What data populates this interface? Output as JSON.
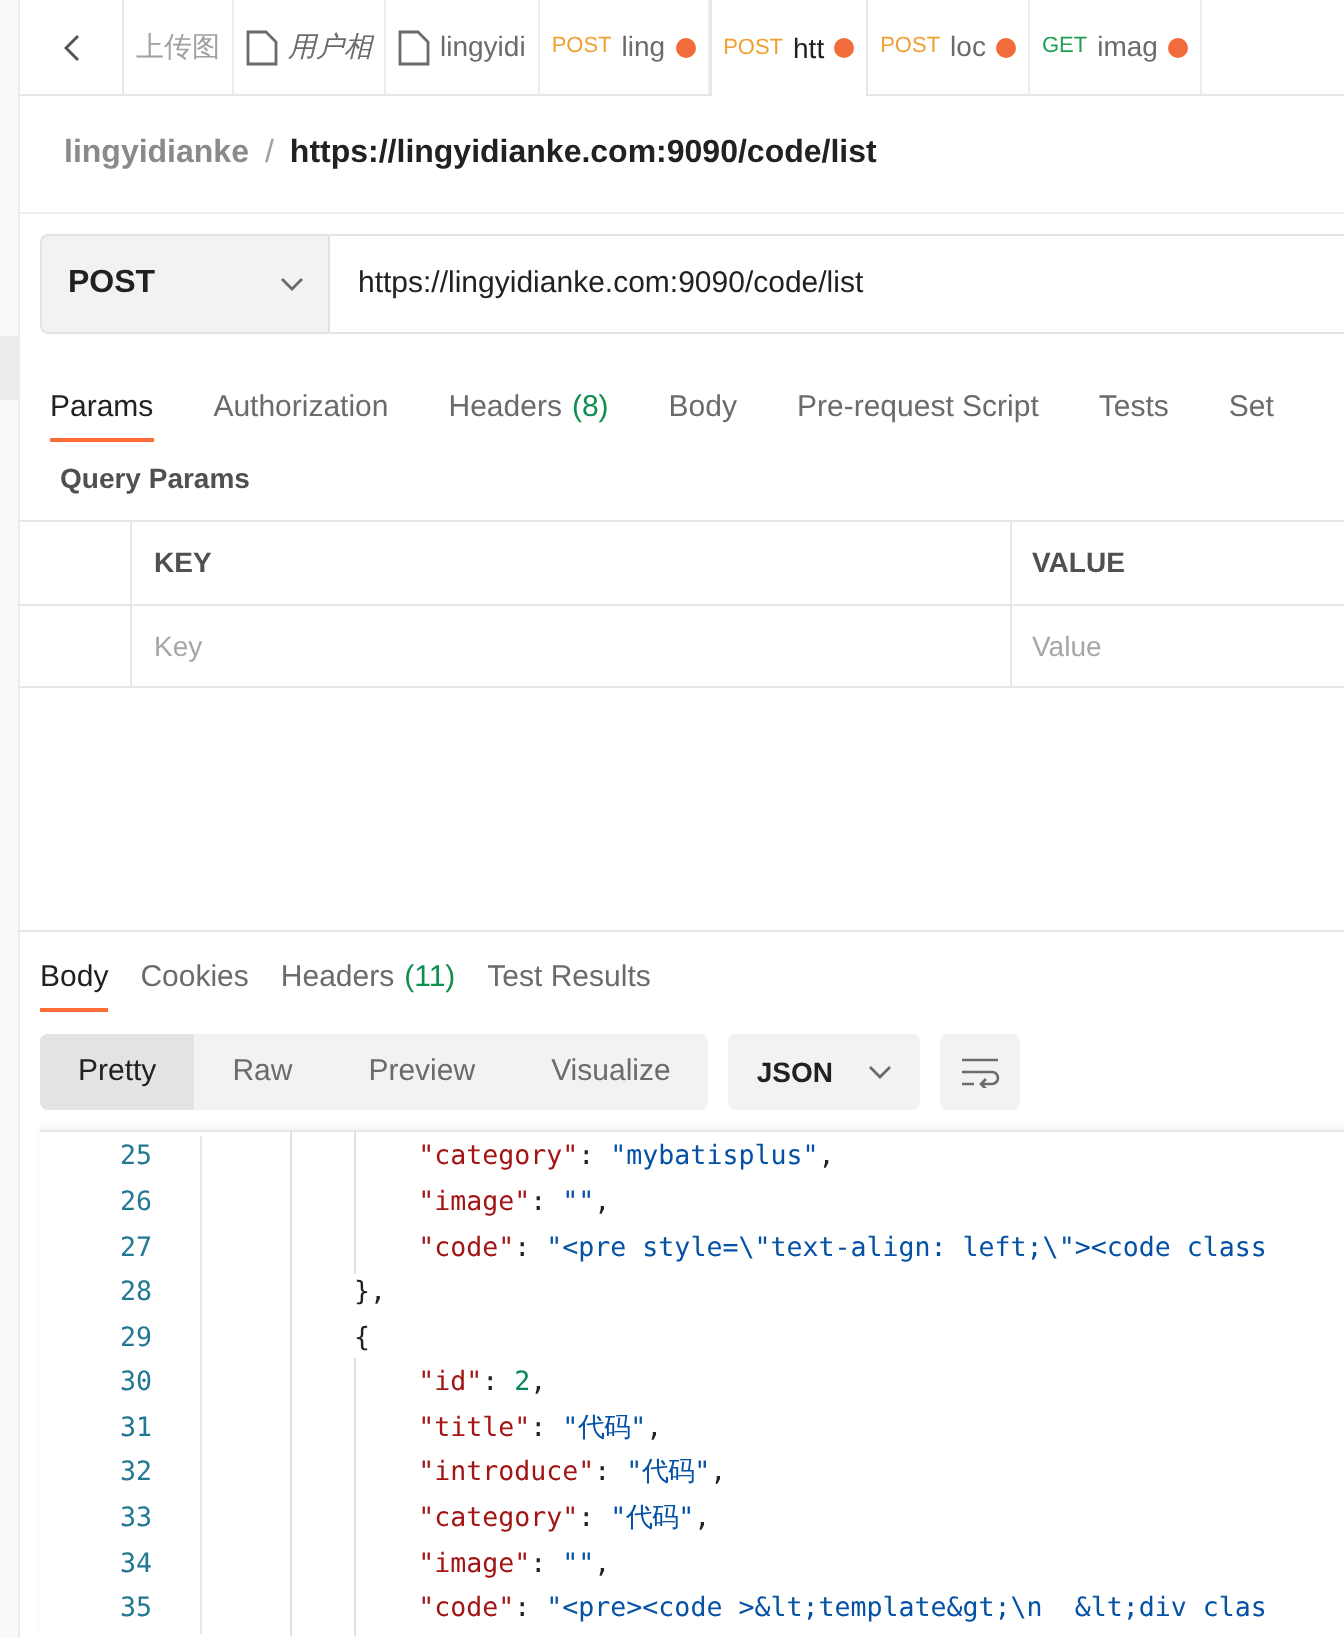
{
  "tabs": [
    {
      "kind": "plain",
      "label": "上传图",
      "italic": false,
      "selected": false,
      "unsaved": false
    },
    {
      "kind": "file",
      "label": "用户相",
      "italic": true,
      "selected": false,
      "unsaved": false
    },
    {
      "kind": "file",
      "label": "lingyidi",
      "italic": false,
      "selected": false,
      "unsaved": false
    },
    {
      "kind": "request",
      "method": "POST",
      "label": "ling",
      "italic": false,
      "selected": false,
      "unsaved": true
    },
    {
      "kind": "request",
      "method": "POST",
      "label": "htt",
      "italic": false,
      "selected": true,
      "unsaved": true
    },
    {
      "kind": "request",
      "method": "POST",
      "label": "loc",
      "italic": false,
      "selected": false,
      "unsaved": true
    },
    {
      "kind": "request",
      "method": "GET",
      "label": "imag",
      "italic": false,
      "selected": false,
      "unsaved": true
    }
  ],
  "breadcrumb": {
    "collection": "lingyidianke",
    "separator": "/",
    "request": "https://lingyidianke.com:9090/code/list"
  },
  "request": {
    "method": "POST",
    "url": "https://lingyidianke.com:9090/code/list"
  },
  "request_tabs": [
    {
      "label": "Params",
      "selected": true
    },
    {
      "label": "Authorization",
      "selected": false
    },
    {
      "label": "Headers",
      "count": "(8)",
      "selected": false
    },
    {
      "label": "Body",
      "selected": false
    },
    {
      "label": "Pre-request Script",
      "selected": false
    },
    {
      "label": "Tests",
      "selected": false
    },
    {
      "label": "Set",
      "selected": false
    }
  ],
  "query_params": {
    "title": "Query Params",
    "columns": [
      "KEY",
      "VALUE"
    ],
    "placeholders": [
      "Key",
      "Value"
    ]
  },
  "response_tabs": [
    {
      "label": "Body",
      "selected": true
    },
    {
      "label": "Cookies",
      "selected": false
    },
    {
      "label": "Headers",
      "count": "(11)",
      "selected": false
    },
    {
      "label": "Test Results",
      "selected": false
    }
  ],
  "view_modes": [
    {
      "label": "Pretty",
      "selected": true
    },
    {
      "label": "Raw",
      "selected": false
    },
    {
      "label": "Preview",
      "selected": false
    },
    {
      "label": "Visualize",
      "selected": false
    }
  ],
  "format": "JSON",
  "code_lines": [
    {
      "number": "25",
      "text": "            \"category\": \"mybatisplus\","
    },
    {
      "number": "26",
      "text": "            \"image\": \"\","
    },
    {
      "number": "27",
      "text": "            \"code\": \"<pre style=\\\"text-align: left;\\\"><code class"
    },
    {
      "number": "28",
      "text": "        },"
    },
    {
      "number": "29",
      "text": "        {"
    },
    {
      "number": "30",
      "text": "            \"id\": 2,"
    },
    {
      "number": "31",
      "text": "            \"title\": \"代码\","
    },
    {
      "number": "32",
      "text": "            \"introduce\": \"代码\","
    },
    {
      "number": "33",
      "text": "            \"category\": \"代码\","
    },
    {
      "number": "34",
      "text": "            \"image\": \"\","
    },
    {
      "number": "35",
      "text": "            \"code\": \"<pre><code >&lt;template&gt;\\n  &lt;div clas"
    }
  ]
}
